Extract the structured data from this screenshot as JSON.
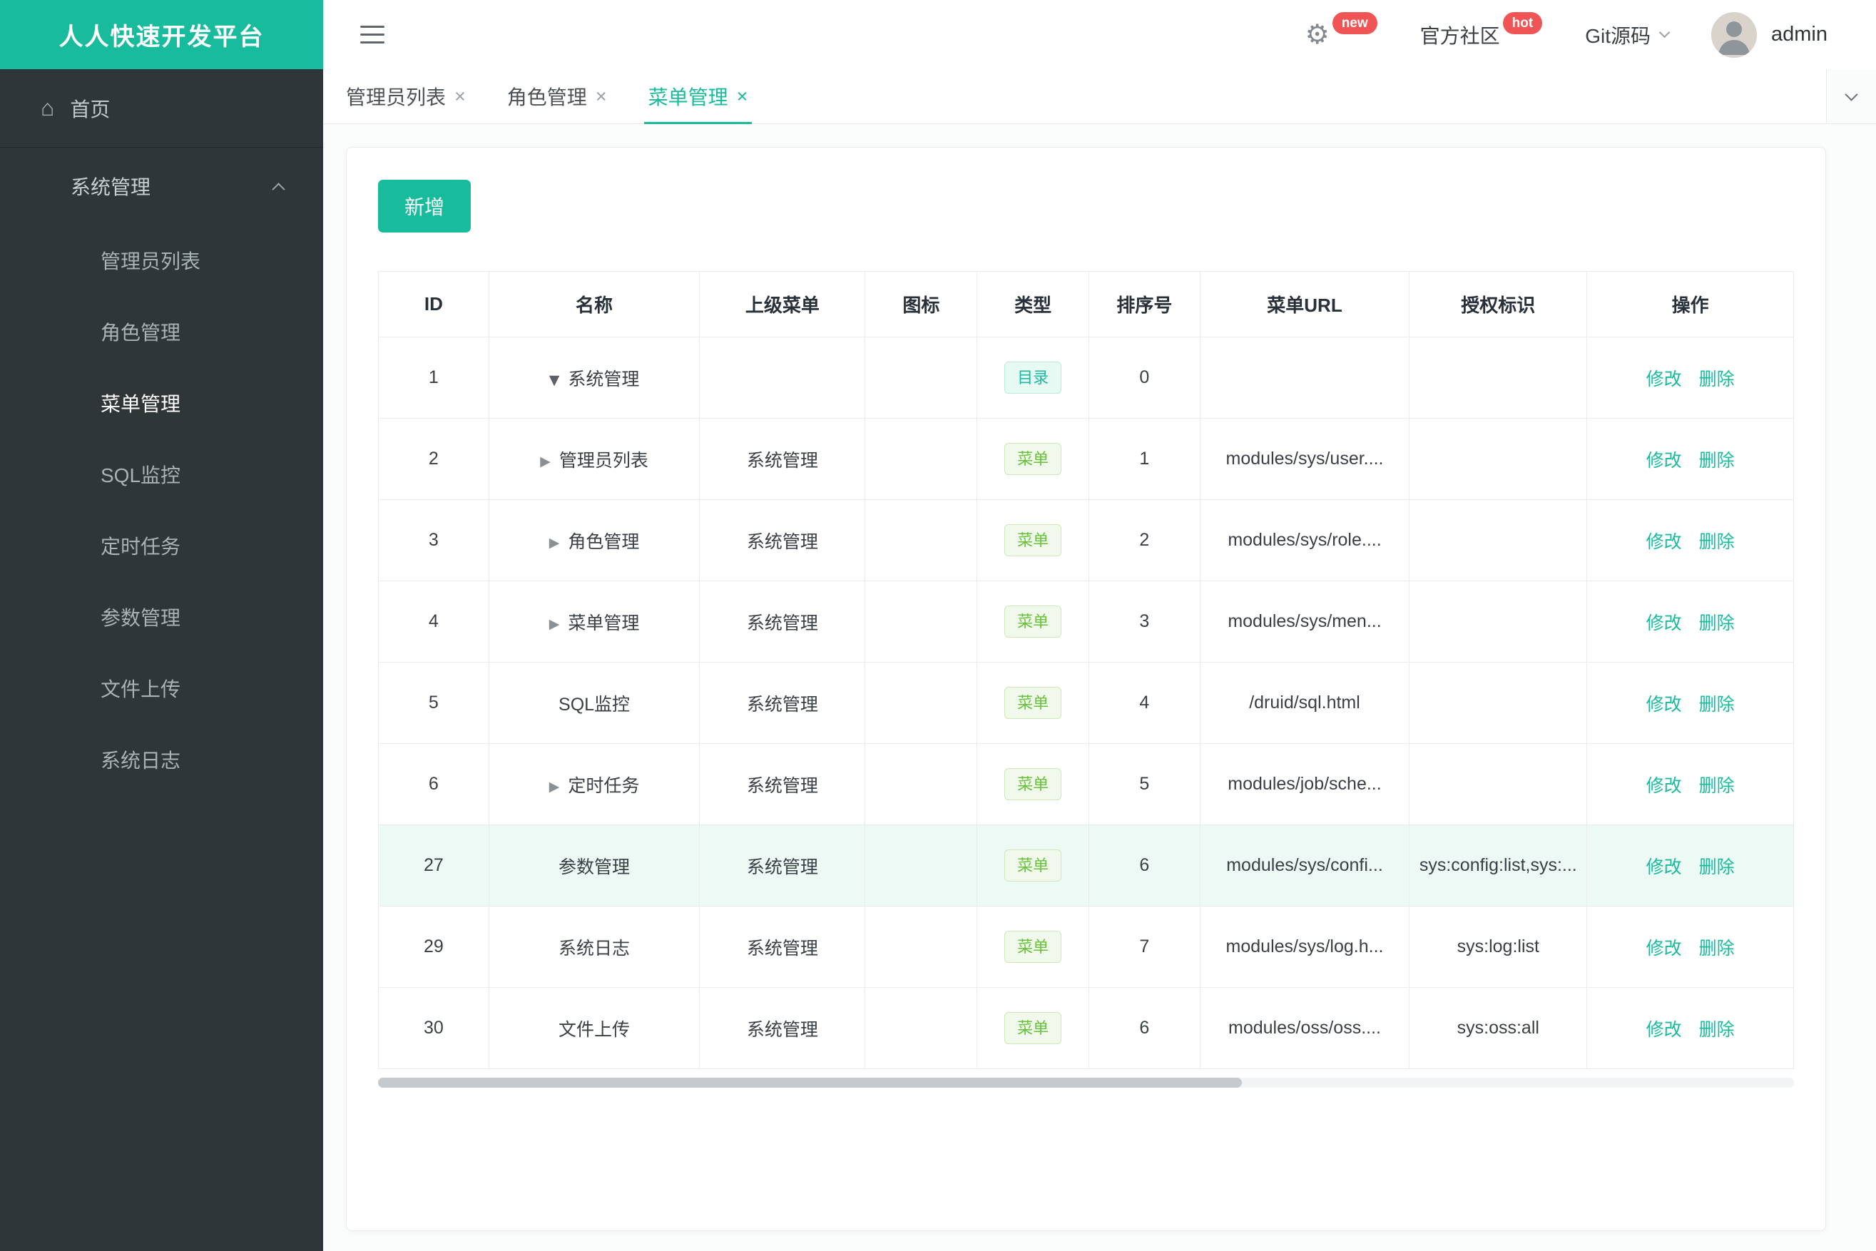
{
  "brand": {
    "title": "人人快速开发平台"
  },
  "colors": {
    "accent": "#18bc9c",
    "badge_red": "#f05454",
    "menu_green": "#67c23a",
    "sidebar_bg": "#2f3638",
    "highlight_row": "#ecf9f4"
  },
  "icons": {
    "home": "⌂",
    "gear": "⚙",
    "close": "×",
    "caret_down": "▼",
    "caret_right": "▶"
  },
  "topbar": {
    "gear_badge": "new",
    "community_label": "官方社区",
    "community_badge": "hot",
    "git_label": "Git源码",
    "username": "admin"
  },
  "sidebar": {
    "home_label": "首页",
    "section_label": "系统管理",
    "items": [
      {
        "label": "管理员列表"
      },
      {
        "label": "角色管理"
      },
      {
        "label": "菜单管理",
        "active": true
      },
      {
        "label": "SQL监控"
      },
      {
        "label": "定时任务"
      },
      {
        "label": "参数管理"
      },
      {
        "label": "文件上传"
      },
      {
        "label": "系统日志"
      }
    ]
  },
  "tabs": [
    {
      "label": "管理员列表"
    },
    {
      "label": "角色管理"
    },
    {
      "label": "菜单管理",
      "active": true
    }
  ],
  "toolbar": {
    "add_label": "新增"
  },
  "table": {
    "columns": [
      "ID",
      "名称",
      "上级菜单",
      "图标",
      "类型",
      "排序号",
      "菜单URL",
      "授权标识",
      "操作"
    ],
    "actions": {
      "edit": "修改",
      "delete": "删除"
    },
    "rows": [
      {
        "id": "1",
        "name": "系统管理",
        "parent": "",
        "icon": "",
        "type": "目录",
        "order": "0",
        "url": "",
        "perm": ""
      },
      {
        "id": "2",
        "name": "管理员列表",
        "parent": "系统管理",
        "icon": "",
        "type": "菜单",
        "order": "1",
        "url": "modules/sys/user....",
        "perm": ""
      },
      {
        "id": "3",
        "name": "角色管理",
        "parent": "系统管理",
        "icon": "",
        "type": "菜单",
        "order": "2",
        "url": "modules/sys/role....",
        "perm": ""
      },
      {
        "id": "4",
        "name": "菜单管理",
        "parent": "系统管理",
        "icon": "",
        "type": "菜单",
        "order": "3",
        "url": "modules/sys/men...",
        "perm": ""
      },
      {
        "id": "5",
        "name": "SQL监控",
        "parent": "系统管理",
        "icon": "",
        "type": "菜单",
        "order": "4",
        "url": "/druid/sql.html",
        "perm": ""
      },
      {
        "id": "6",
        "name": "定时任务",
        "parent": "系统管理",
        "icon": "",
        "type": "菜单",
        "order": "5",
        "url": "modules/job/sche...",
        "perm": ""
      },
      {
        "id": "27",
        "name": "参数管理",
        "parent": "系统管理",
        "icon": "",
        "type": "菜单",
        "order": "6",
        "url": "modules/sys/confi...",
        "perm": "sys:config:list,sys:..."
      },
      {
        "id": "29",
        "name": "系统日志",
        "parent": "系统管理",
        "icon": "",
        "type": "菜单",
        "order": "7",
        "url": "modules/sys/log.h...",
        "perm": "sys:log:list"
      },
      {
        "id": "30",
        "name": "文件上传",
        "parent": "系统管理",
        "icon": "",
        "type": "菜单",
        "order": "6",
        "url": "modules/oss/oss....",
        "perm": "sys:oss:all"
      }
    ]
  }
}
